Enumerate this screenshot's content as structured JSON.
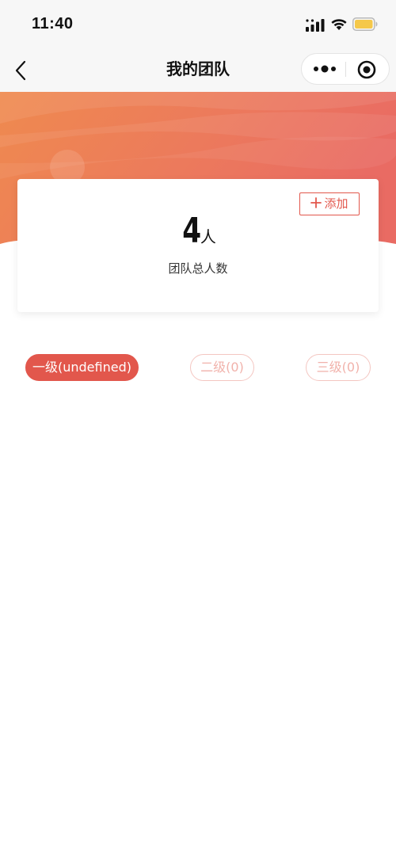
{
  "status_bar": {
    "time": "11:40",
    "icons": [
      "signal-icon",
      "wifi-icon",
      "battery-icon"
    ],
    "battery_color": "#f5c84a"
  },
  "nav": {
    "title": "我的团队",
    "back_icon": "back-icon",
    "more_icon": "more-icon",
    "close_icon": "close-mini-program-icon"
  },
  "summary": {
    "add_label": "添加",
    "add_icon": "plus-icon",
    "count": "4",
    "unit": "人",
    "label": "团队总人数"
  },
  "tabs": [
    {
      "label": "一级(undefined)",
      "active": true
    },
    {
      "label": "二级(0)",
      "active": false
    },
    {
      "label": "三级(0)",
      "active": false
    }
  ],
  "colors": {
    "accent": "#e2574c",
    "tab_inactive_text": "#f1b2ab",
    "banner_start": "#ef8a4f",
    "banner_end": "#e96b63"
  }
}
